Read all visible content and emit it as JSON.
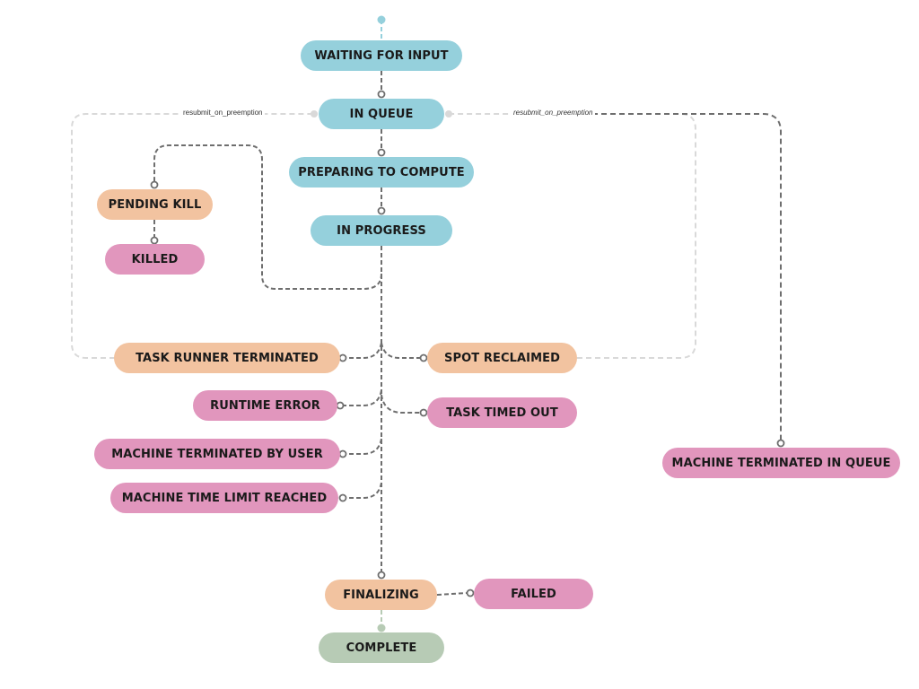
{
  "colors": {
    "blue": "#95d0dc",
    "orange": "#f2c3a0",
    "pink": "#e196bd",
    "green": "#b7cbb5",
    "edge": "#6e6e6e",
    "edge_light": "#d9d9d9",
    "start_dot": "#95d0dc",
    "end_dot": "#b7cbb5"
  },
  "nodes": {
    "waiting_for_input": "WAITING FOR INPUT",
    "in_queue": "IN QUEUE",
    "preparing_to_compute": "PREPARING TO COMPUTE",
    "in_progress": "IN PROGRESS",
    "pending_kill": "PENDING KILL",
    "killed": "KILLED",
    "task_runner_terminated": "TASK RUNNER TERMINATED",
    "spot_reclaimed": "SPOT RECLAIMED",
    "runtime_error": "RUNTIME ERROR",
    "task_timed_out": "TASK TIMED OUT",
    "machine_terminated_by_user": "MACHINE TERMINATED BY USER",
    "machine_time_limit_reached": "MACHINE TIME LIMIT REACHED",
    "machine_terminated_in_queue": "MACHINE TERMINATED IN QUEUE",
    "finalizing": "FINALIZING",
    "failed": "FAILED",
    "complete": "COMPLETE"
  },
  "edge_labels": {
    "resubmit_left": "resubmit_on_preemption",
    "resubmit_right": "resubmit_on_preemption"
  }
}
